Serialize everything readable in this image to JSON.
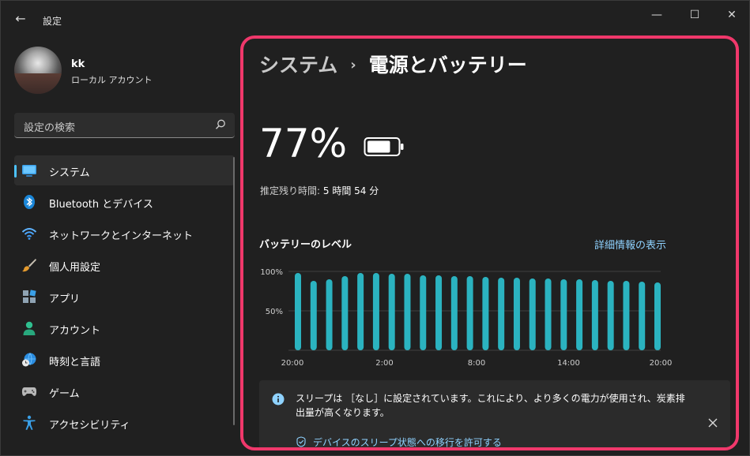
{
  "window": {
    "title": "設定",
    "back_glyph": "←",
    "min_glyph": "—",
    "max_glyph": "☐",
    "close_glyph": "✕"
  },
  "user": {
    "name": "kk",
    "account_type": "ローカル アカウント"
  },
  "search": {
    "placeholder": "設定の検索"
  },
  "nav": [
    {
      "label": "システム",
      "icon": "monitor-icon",
      "active": true
    },
    {
      "label": "Bluetooth とデバイス",
      "icon": "bluetooth-icon",
      "active": false
    },
    {
      "label": "ネットワークとインターネット",
      "icon": "wifi-icon",
      "active": false
    },
    {
      "label": "個人用設定",
      "icon": "brush-icon",
      "active": false
    },
    {
      "label": "アプリ",
      "icon": "apps-icon",
      "active": false
    },
    {
      "label": "アカウント",
      "icon": "person-icon",
      "active": false
    },
    {
      "label": "時刻と言語",
      "icon": "globe-clock-icon",
      "active": false
    },
    {
      "label": "ゲーム",
      "icon": "gamepad-icon",
      "active": false
    },
    {
      "label": "アクセシビリティ",
      "icon": "accessibility-icon",
      "active": false
    }
  ],
  "breadcrumb": {
    "parent": "システム",
    "separator": "›",
    "current": "電源とバッテリー"
  },
  "battery": {
    "percent": "77%",
    "level": 77,
    "remaining_label": "推定残り時間:",
    "remaining_value": "5 時間 54 分"
  },
  "level_section": {
    "title": "バッテリーのレベル",
    "details_link": "詳細情報の表示"
  },
  "chart_data": {
    "type": "bar",
    "x_ticks": [
      "20:00",
      "2:00",
      "8:00",
      "14:00",
      "20:00"
    ],
    "y_ticks": [
      "100%",
      "50%"
    ],
    "ylim": [
      0,
      100
    ],
    "values": [
      98,
      88,
      90,
      94,
      98,
      98,
      97,
      97,
      95,
      95,
      94,
      94,
      93,
      92,
      92,
      91,
      91,
      90,
      90,
      89,
      88,
      88,
      87,
      86
    ],
    "grid": true,
    "bar_color": "#2bb3c0"
  },
  "info_card": {
    "text": "スリープは ［なし］に設定されています。これにより、より多くの電力が使用され、炭素排出量が高くなります。",
    "action": "デバイスのスリープ状態への移行を許可する"
  },
  "colors": {
    "accent": "#4cc2ff",
    "highlight_border": "#f0386b",
    "link": "#8fd2ff"
  }
}
